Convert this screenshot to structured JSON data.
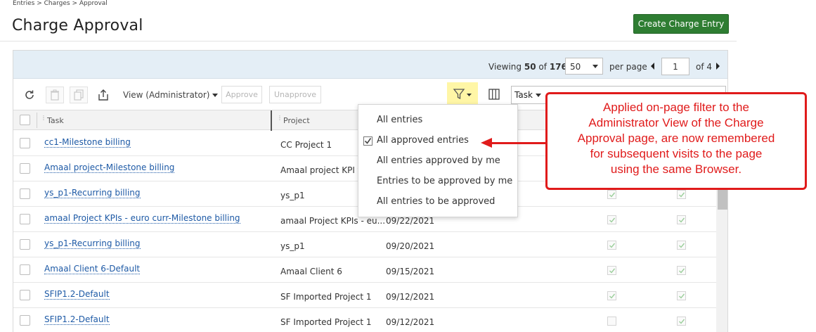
{
  "breadcrumb": "Entries > Charges > Approval",
  "page_title": "Charge Approval",
  "create_button": "Create Charge Entry",
  "pager": {
    "viewing_label": "Viewing",
    "viewing_count": "50",
    "of_label": "of",
    "total": "176",
    "per_page_value": "50",
    "per_page_label": "per page",
    "current_page": "1",
    "of_pages": "of 4"
  },
  "toolbar": {
    "view_label": "View (Administrator)",
    "approve": "Approve",
    "unapprove": "Unapprove",
    "search_field": "Task"
  },
  "columns": {
    "task": "Task",
    "project": "Project"
  },
  "rows": [
    {
      "task": "cc1-Milestone billing",
      "project": "CC Project 1",
      "date": "",
      "c1": false,
      "c2": false
    },
    {
      "task": "Amaal project-Milestone billing",
      "project": "Amaal project KPI te",
      "date": "",
      "c1": false,
      "c2": false
    },
    {
      "task": "ys_p1-Recurring billing",
      "project": "ys_p1",
      "date": "",
      "c1": true,
      "c2": true
    },
    {
      "task": "amaal Project KPIs - euro curr-Milestone billing",
      "project": "amaal Project KPIs - eu...",
      "date": "09/22/2021",
      "c1": true,
      "c2": true
    },
    {
      "task": "ys_p1-Recurring billing",
      "project": "ys_p1",
      "date": "09/20/2021",
      "c1": true,
      "c2": true
    },
    {
      "task": "Amaal Client 6-Default",
      "project": "Amaal Client 6",
      "date": "09/15/2021",
      "c1": true,
      "c2": true
    },
    {
      "task": "SFIP1.2-Default",
      "project": "SF Imported Project 1",
      "date": "09/12/2021",
      "c1": true,
      "c2": true
    },
    {
      "task": "SFIP1.2-Default",
      "project": "SF Imported Project 1",
      "date": "09/12/2021",
      "c1": false,
      "c2": true
    }
  ],
  "filter_menu": {
    "items": [
      "All entries",
      "All approved entries",
      "All entries approved by me",
      "Entries to be approved by me",
      "All entries to be approved"
    ],
    "selected_index": 1
  },
  "callout": {
    "lines": [
      "Applied on-page filter to the",
      "Administrator View of the Charge",
      "Approval page, are now remembered",
      "for subsequent visits to the page",
      "using the same Browser."
    ]
  },
  "colors": {
    "accent_green": "#2e7d32",
    "link_blue": "#1e5aa6",
    "annotation_red": "#e01b1b",
    "filter_highlight": "#fff6a6"
  },
  "icons": {
    "refresh": "refresh-icon",
    "delete": "trash-icon",
    "copy": "copy-icon",
    "export": "export-icon",
    "filter": "filter-icon",
    "columns": "columns-icon"
  }
}
